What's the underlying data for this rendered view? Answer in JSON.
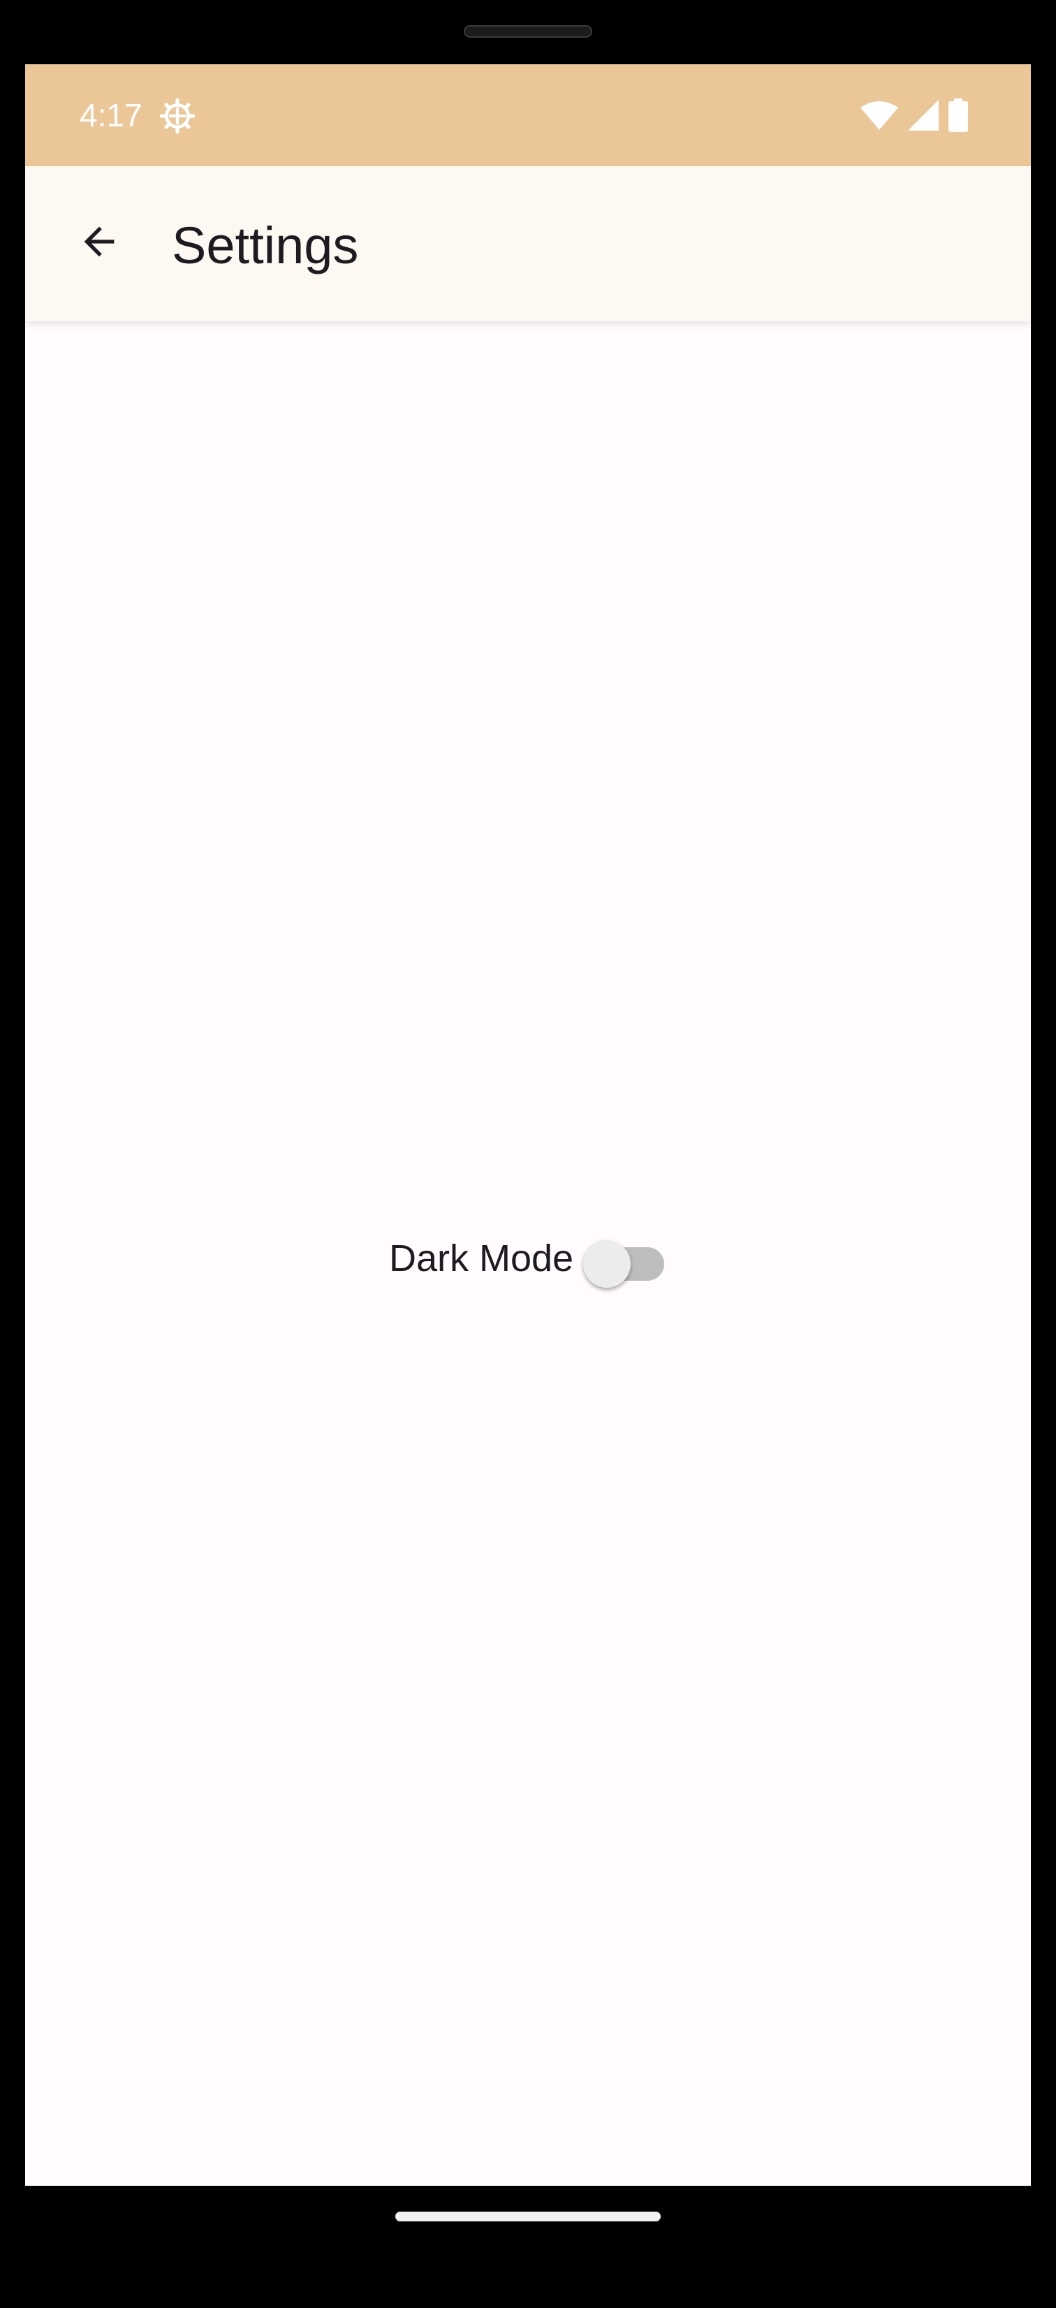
{
  "status_bar": {
    "time": "4:17",
    "icons": [
      "settings-gear-icon",
      "wifi-icon",
      "cellular-signal-icon",
      "battery-icon"
    ],
    "background_color": "#ebc797"
  },
  "app_bar": {
    "back_icon": "arrow-back-icon",
    "title": "Settings",
    "background_color": "#fdf8f2"
  },
  "settings": {
    "dark_mode": {
      "label": "Dark Mode",
      "enabled": false
    }
  },
  "colors": {
    "screen_background": "#fffbfe",
    "text": "#1d1b20",
    "switch_track_off": "#bdbdbd",
    "switch_thumb_off": "#ececec"
  }
}
